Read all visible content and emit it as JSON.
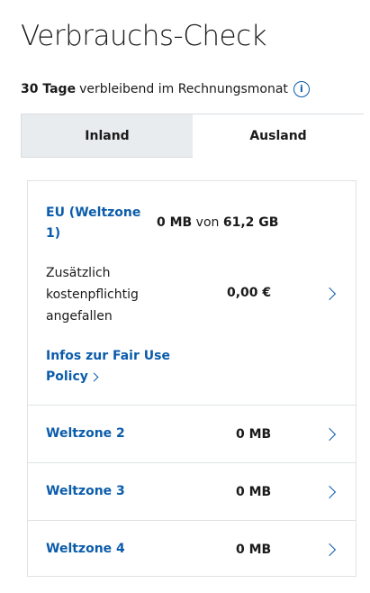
{
  "header": {
    "title": "Verbrauchs-Check",
    "days_bold": "30 Tage",
    "days_rest": "verbleibend im Rechnungsmonat",
    "info_glyph": "i"
  },
  "tabs": [
    {
      "label": "Inland",
      "active": false
    },
    {
      "label": "Ausland",
      "active": true
    }
  ],
  "eu_section": {
    "zone_label_line1": "EU (Weltzone",
    "zone_label_line2": "1)",
    "used": "0 MB",
    "of_word": "von",
    "total": "61,2 GB",
    "extra_line1": "Zusätzlich",
    "extra_line2": "kostenpflichtig",
    "extra_line3": "angefallen",
    "extra_amount": "0,00 €",
    "fair_use_line1": "Infos zur Fair Use",
    "fair_use_line2": "Policy"
  },
  "zones": [
    {
      "label": "Weltzone 2",
      "value": "0 MB"
    },
    {
      "label": "Weltzone 3",
      "value": "0 MB"
    },
    {
      "label": "Weltzone 4",
      "value": "0 MB"
    }
  ],
  "colors": {
    "accent": "#0b5cab",
    "tab_inactive_bg": "#e8ecef",
    "border": "#dfe3e6"
  }
}
